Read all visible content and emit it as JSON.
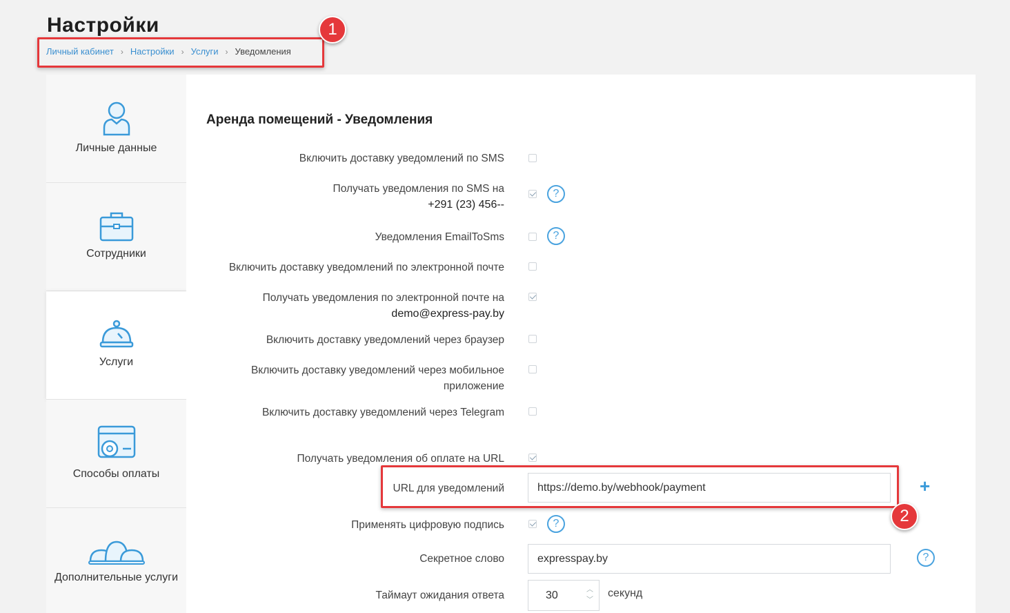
{
  "page": {
    "title": "Настройки",
    "breadcrumb": [
      "Личный кабинет",
      "Настройки",
      "Услуги",
      "Уведомления"
    ]
  },
  "annotations": [
    "1",
    "2"
  ],
  "sidebar": {
    "items": [
      {
        "label": "Личные данные",
        "icon": "user-icon",
        "active": false
      },
      {
        "label": "Сотрудники",
        "icon": "briefcase-icon",
        "active": false
      },
      {
        "label": "Услуги",
        "icon": "service-bell-icon",
        "active": true
      },
      {
        "label": "Способы оплаты",
        "icon": "payment-settings-icon",
        "active": false
      },
      {
        "label": "Дополнительные услуги",
        "icon": "service-bells-icon",
        "active": false
      }
    ]
  },
  "main": {
    "section_title": "Аренда помещений - Уведомления",
    "settings": [
      {
        "label": "Включить доставку уведомлений по SMS",
        "checked": false
      },
      {
        "label": "Получать уведомления по SMS на",
        "value": "+291 (23) 456--",
        "checked": true
      },
      {
        "label": "Уведомления EmailToSms",
        "checked": false
      },
      {
        "label": "Включить доставку уведомлений по электронной почте",
        "checked": false
      },
      {
        "label": "Получать уведомления по электронной почте на",
        "value": "demo@express-pay.by",
        "checked": true
      },
      {
        "label": "Включить доставку уведомлений через браузер",
        "checked": false
      },
      {
        "label": "Включить доставку уведомлений через мобильное",
        "label2": "приложение",
        "checked": false
      },
      {
        "label": "Включить доставку уведомлений через Telegram",
        "checked": false
      },
      {
        "label": "Получать уведомления об оплате на URL",
        "checked": true
      },
      {
        "label": "Применять цифровую подпись",
        "checked": true
      }
    ],
    "url_field": {
      "label": "URL для уведомлений",
      "value": "https://demo.by/webhook/payment"
    },
    "secret_field": {
      "label": "Секретное слово",
      "value": "expresspay.by"
    },
    "timeout_field": {
      "label": "Таймаут ожидания ответа",
      "value": "30",
      "unit": "секунд"
    },
    "help_glyph": "?",
    "plus_glyph": "+"
  },
  "colors": {
    "accent": "#3a9ad9",
    "annotation": "#e5383b"
  }
}
